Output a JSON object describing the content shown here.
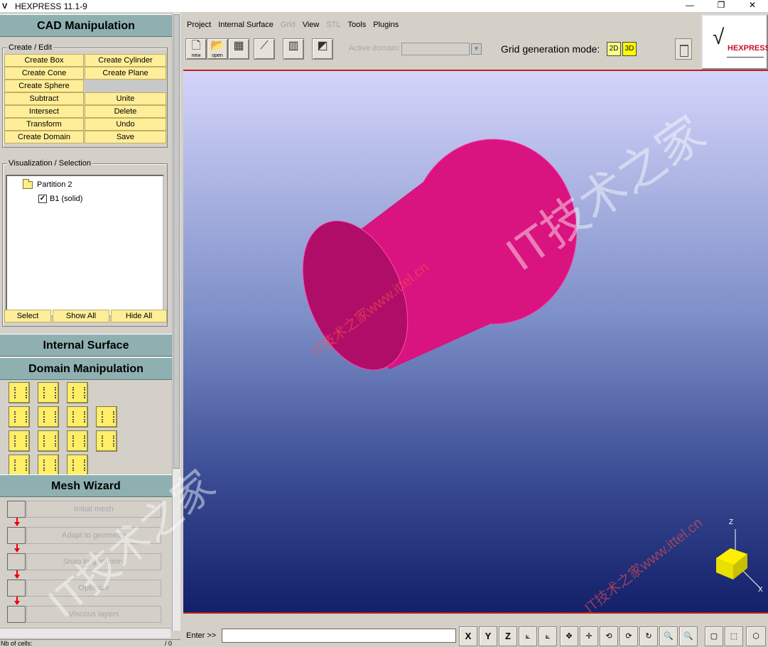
{
  "window": {
    "title": "HEXPRESS 11.1-9",
    "minimize": "—",
    "restore": "❐",
    "close": "✕"
  },
  "left": {
    "cad_header": "CAD Manipulation",
    "create_edit_legend": "Create / Edit",
    "cad_buttons": [
      "Create Box",
      "Create Cylinder",
      "Create Cone",
      "Create Plane",
      "Create Sphere",
      "",
      "Subtract",
      "Unite",
      "Intersect",
      "Delete",
      "Transform",
      "Undo",
      "Create Domain",
      "Save"
    ],
    "vis_legend": "Visualization / Selection",
    "tree": {
      "partition": "Partition 2",
      "solid": "B1 (solid)",
      "solid_checked": "✓"
    },
    "sel_buttons": [
      "Select",
      "Show All",
      "Hide All"
    ],
    "internal_header": "Internal Surface",
    "domain_header": "Domain Manipulation",
    "mesh_header": "Mesh Wizard",
    "wizard_steps": [
      "Initial mesh",
      "Adapt to geometry",
      "Snap to geometry",
      "Optimize",
      "Viscous layers"
    ],
    "status_label": "Nb of cells:",
    "status_value": "/ 0"
  },
  "menus": [
    "Project",
    "Internal Surface",
    "Grid",
    "View",
    "STL",
    "Tools",
    "Plugins"
  ],
  "toolbar": {
    "new_label": "new",
    "open_label": "open",
    "active_domain": "Active domain:",
    "grid_mode_label": "Grid generation mode:",
    "mode_2d": "2D",
    "mode_3d": "3D",
    "logo_text": "HEXPRESS"
  },
  "viewport": {
    "axis_z": "Z",
    "axis_x": "X",
    "cylinder_color": "#e0168a",
    "watermarks": [
      "IT技术之家",
      "IT技术之家www.ittel.cn",
      "IT技术之家",
      "IT技术之家www.ittel.cn"
    ]
  },
  "cmd": {
    "label": "Enter >>",
    "view_buttons": [
      "X",
      "Y",
      "Z"
    ]
  }
}
